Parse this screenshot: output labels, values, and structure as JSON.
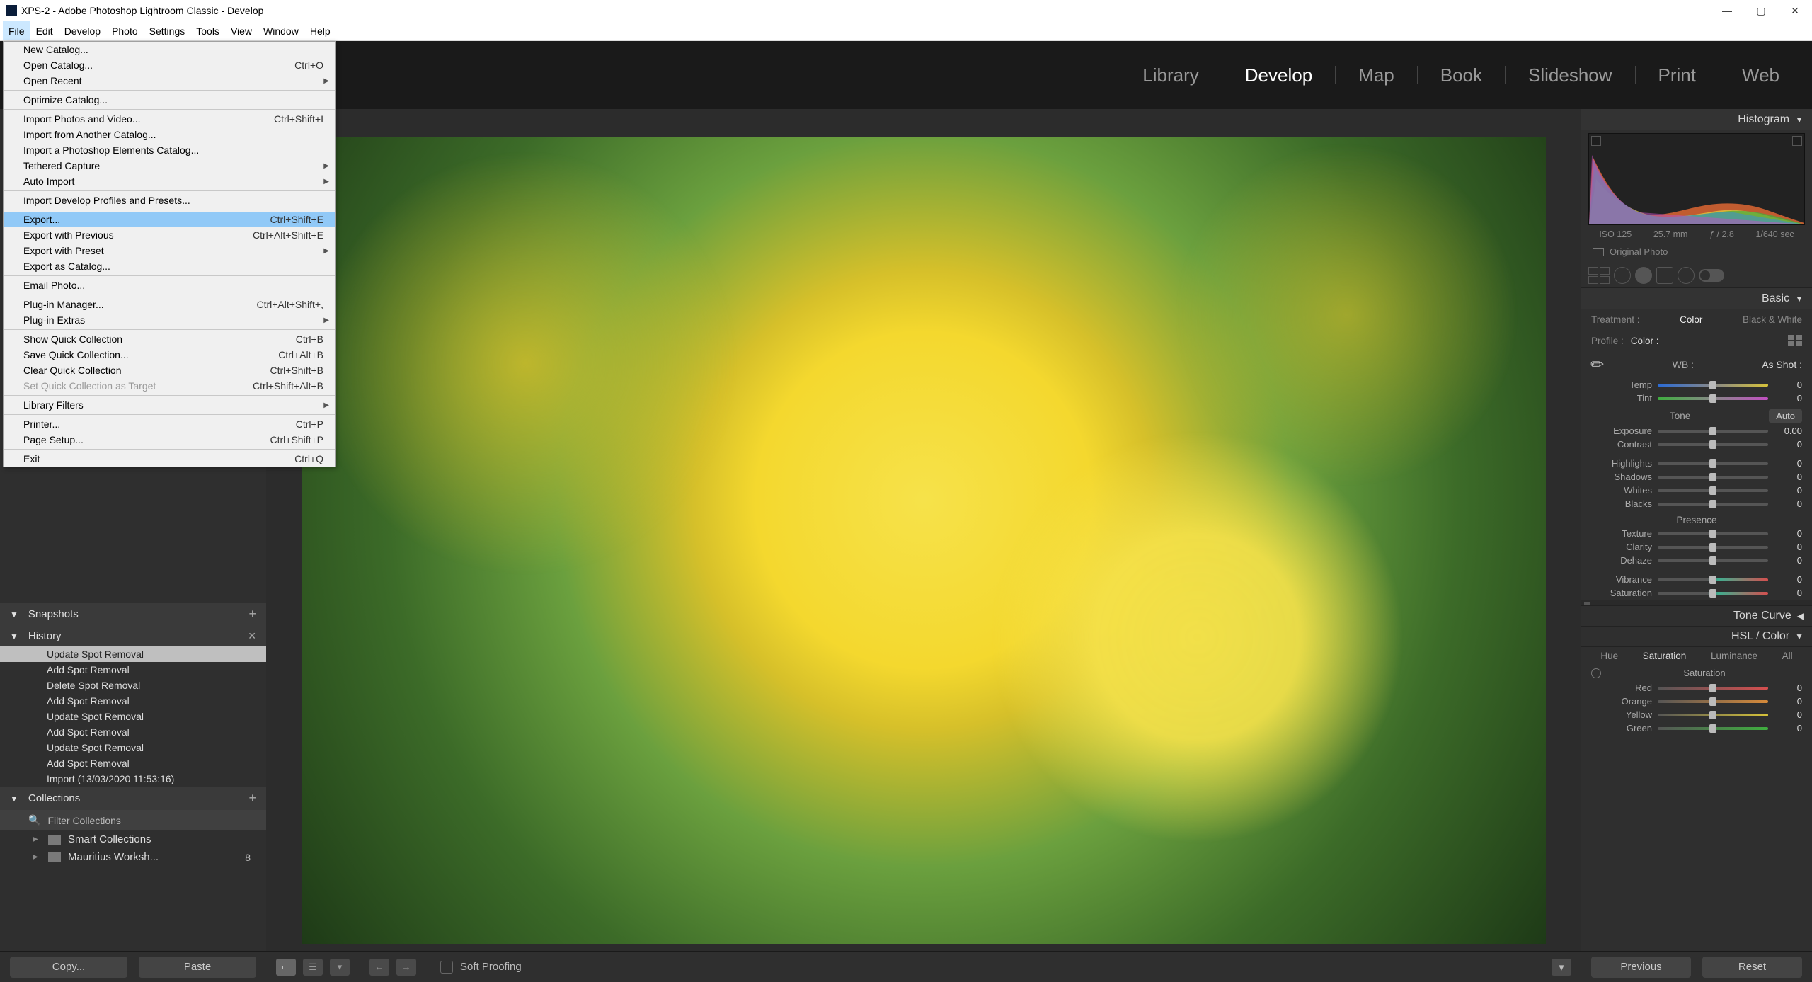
{
  "window": {
    "title": "XPS-2 - Adobe Photoshop Lightroom Classic - Develop"
  },
  "menubar": [
    "File",
    "Edit",
    "Develop",
    "Photo",
    "Settings",
    "Tools",
    "View",
    "Window",
    "Help"
  ],
  "file_menu": [
    {
      "label": "New Catalog...",
      "shortcut": "",
      "type": "item"
    },
    {
      "label": "Open Catalog...",
      "shortcut": "Ctrl+O",
      "type": "item"
    },
    {
      "label": "Open Recent",
      "shortcut": "",
      "type": "sub"
    },
    {
      "type": "sep"
    },
    {
      "label": "Optimize Catalog...",
      "shortcut": "",
      "type": "item"
    },
    {
      "type": "sep"
    },
    {
      "label": "Import Photos and Video...",
      "shortcut": "Ctrl+Shift+I",
      "type": "item"
    },
    {
      "label": "Import from Another Catalog...",
      "shortcut": "",
      "type": "item"
    },
    {
      "label": "Import a Photoshop Elements Catalog...",
      "shortcut": "",
      "type": "item"
    },
    {
      "label": "Tethered Capture",
      "shortcut": "",
      "type": "sub"
    },
    {
      "label": "Auto Import",
      "shortcut": "",
      "type": "sub"
    },
    {
      "type": "sep"
    },
    {
      "label": "Import Develop Profiles and Presets...",
      "shortcut": "",
      "type": "item"
    },
    {
      "type": "sep"
    },
    {
      "label": "Export...",
      "shortcut": "Ctrl+Shift+E",
      "type": "item",
      "highlight": true
    },
    {
      "label": "Export with Previous",
      "shortcut": "Ctrl+Alt+Shift+E",
      "type": "item"
    },
    {
      "label": "Export with Preset",
      "shortcut": "",
      "type": "sub"
    },
    {
      "label": "Export as Catalog...",
      "shortcut": "",
      "type": "item"
    },
    {
      "type": "sep"
    },
    {
      "label": "Email Photo...",
      "shortcut": "",
      "type": "item"
    },
    {
      "type": "sep"
    },
    {
      "label": "Plug-in Manager...",
      "shortcut": "Ctrl+Alt+Shift+,",
      "type": "item"
    },
    {
      "label": "Plug-in Extras",
      "shortcut": "",
      "type": "sub"
    },
    {
      "type": "sep"
    },
    {
      "label": "Show Quick Collection",
      "shortcut": "Ctrl+B",
      "type": "item"
    },
    {
      "label": "Save Quick Collection...",
      "shortcut": "Ctrl+Alt+B",
      "type": "item"
    },
    {
      "label": "Clear Quick Collection",
      "shortcut": "Ctrl+Shift+B",
      "type": "item"
    },
    {
      "label": "Set Quick Collection as Target",
      "shortcut": "Ctrl+Shift+Alt+B",
      "type": "item",
      "disabled": true
    },
    {
      "type": "sep"
    },
    {
      "label": "Library Filters",
      "shortcut": "",
      "type": "sub"
    },
    {
      "type": "sep"
    },
    {
      "label": "Printer...",
      "shortcut": "Ctrl+P",
      "type": "item"
    },
    {
      "label": "Page Setup...",
      "shortcut": "Ctrl+Shift+P",
      "type": "item"
    },
    {
      "type": "sep"
    },
    {
      "label": "Exit",
      "shortcut": "Ctrl+Q",
      "type": "item"
    }
  ],
  "modules": [
    "Library",
    "Develop",
    "Map",
    "Book",
    "Slideshow",
    "Print",
    "Web"
  ],
  "active_module": "Develop",
  "left": {
    "snapshots_title": "Snapshots",
    "history_title": "History",
    "history": [
      "Update Spot Removal",
      "Add Spot Removal",
      "Delete Spot Removal",
      "Add Spot Removal",
      "Update Spot Removal",
      "Add Spot Removal",
      "Update Spot Removal",
      "Add Spot Removal",
      "Import (13/03/2020 11:53:16)"
    ],
    "collections_title": "Collections",
    "filter_placeholder": "Filter Collections",
    "collections": [
      {
        "name": "Smart Collections",
        "count": ""
      },
      {
        "name": "Mauritius Worksh...",
        "count": "8"
      }
    ],
    "copy_btn": "Copy...",
    "paste_btn": "Paste"
  },
  "center_toolbar": {
    "soft_proofing": "Soft Proofing"
  },
  "right": {
    "histogram_title": "Histogram",
    "meta": {
      "iso": "ISO 125",
      "focal": "25.7 mm",
      "aperture": "ƒ / 2.8",
      "shutter": "1/640 sec"
    },
    "original_photo": "Original Photo",
    "basic_title": "Basic",
    "treatment_label": "Treatment :",
    "treatment_color": "Color",
    "treatment_bw": "Black & White",
    "profile_label": "Profile :",
    "profile_value": "Color :",
    "wb_label": "WB :",
    "wb_value": "As Shot :",
    "sliders_wb": [
      {
        "label": "Temp",
        "value": "0",
        "track": "temp",
        "pos": 50
      },
      {
        "label": "Tint",
        "value": "0",
        "track": "tint",
        "pos": 50
      }
    ],
    "tone_label": "Tone",
    "auto_label": "Auto",
    "sliders_tone": [
      {
        "label": "Exposure",
        "value": "0.00",
        "track": "gray",
        "pos": 50
      },
      {
        "label": "Contrast",
        "value": "0",
        "track": "gray",
        "pos": 50
      }
    ],
    "sliders_tone2": [
      {
        "label": "Highlights",
        "value": "0",
        "track": "gray",
        "pos": 50
      },
      {
        "label": "Shadows",
        "value": "0",
        "track": "gray",
        "pos": 50
      },
      {
        "label": "Whites",
        "value": "0",
        "track": "gray",
        "pos": 50
      },
      {
        "label": "Blacks",
        "value": "0",
        "track": "gray",
        "pos": 50
      }
    ],
    "presence_label": "Presence",
    "sliders_presence": [
      {
        "label": "Texture",
        "value": "0",
        "track": "gray",
        "pos": 50
      },
      {
        "label": "Clarity",
        "value": "0",
        "track": "gray",
        "pos": 50
      },
      {
        "label": "Dehaze",
        "value": "0",
        "track": "gray",
        "pos": 50
      }
    ],
    "sliders_vibrance": [
      {
        "label": "Vibrance",
        "value": "0",
        "track": "vib",
        "pos": 50
      },
      {
        "label": "Saturation",
        "value": "0",
        "track": "vib",
        "pos": 50
      }
    ],
    "tone_curve_title": "Tone Curve",
    "hsl_title": "HSL / Color",
    "hsl_tabs": [
      "Hue",
      "Saturation",
      "Luminance",
      "All"
    ],
    "hsl_active": "Saturation",
    "saturation_header": "Saturation",
    "sliders_sat": [
      {
        "label": "Red",
        "value": "0",
        "track": "sat-red",
        "pos": 50
      },
      {
        "label": "Orange",
        "value": "0",
        "track": "sat-orange",
        "pos": 50
      },
      {
        "label": "Yellow",
        "value": "0",
        "track": "sat-yellow",
        "pos": 50
      },
      {
        "label": "Green",
        "value": "0",
        "track": "sat-green",
        "pos": 50
      }
    ],
    "previous_btn": "Previous",
    "reset_btn": "Reset"
  }
}
